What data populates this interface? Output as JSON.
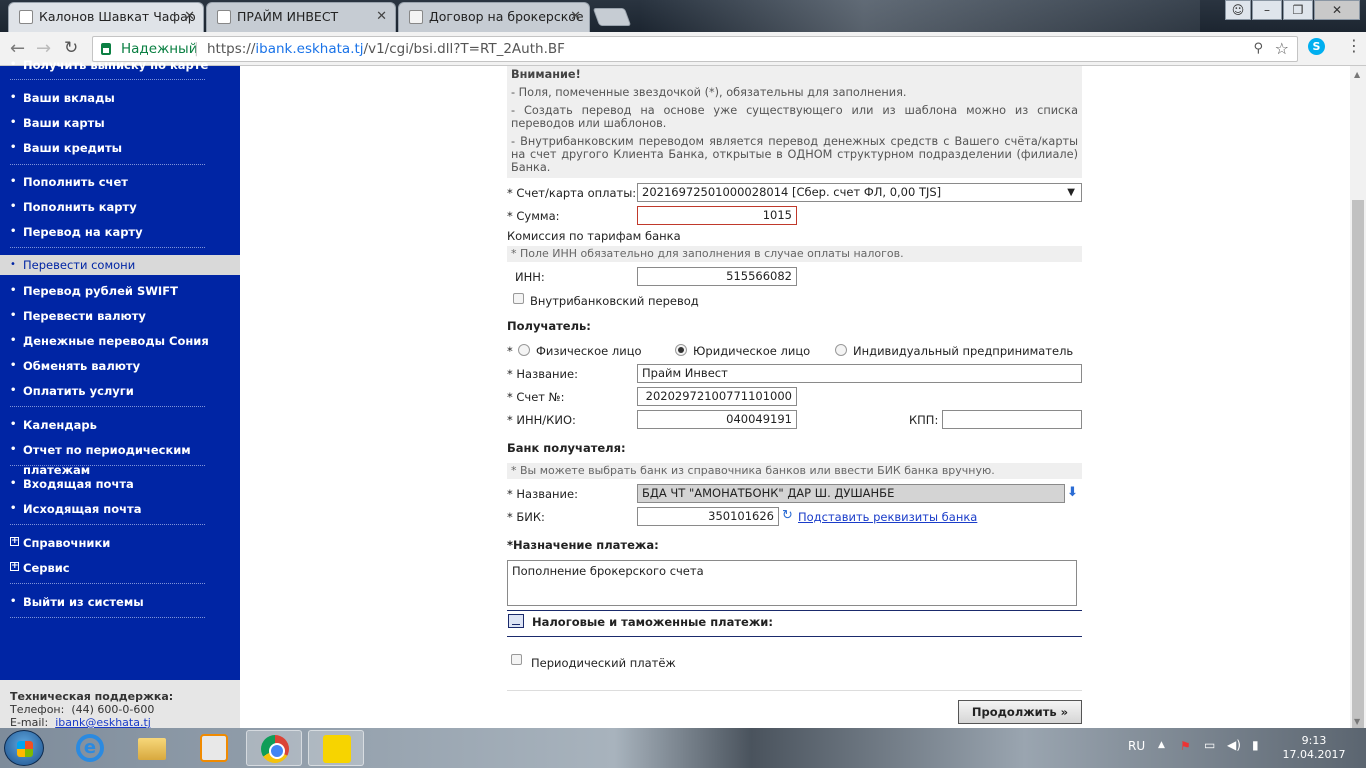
{
  "browser": {
    "tabs": [
      {
        "title": "Калонов Шавкат Чафар",
        "active": true
      },
      {
        "title": "ПРАЙМ ИНВЕСТ",
        "active": false
      },
      {
        "title": "Договор на брокерское",
        "active": false
      }
    ],
    "security_label": "Надежный",
    "url_scheme": "https://",
    "url_host": "ibank.eskhata.tj",
    "url_path": "/v1/cgi/bsi.dll?T=RT_2Auth.BF",
    "skype_letter": "S"
  },
  "sidebar": {
    "items": [
      {
        "label": "Получить выписку по карте",
        "marker": "•"
      },
      {
        "label": "Ваши вклады",
        "marker": "•"
      },
      {
        "label": "Ваши карты",
        "marker": "•"
      },
      {
        "label": "Ваши кредиты",
        "marker": "•"
      },
      {
        "label": "Пополнить счет",
        "marker": "•"
      },
      {
        "label": "Пополнить карту",
        "marker": "•"
      },
      {
        "label": "Перевод на карту",
        "marker": "•"
      },
      {
        "label": "Перевести сомони",
        "marker": "•",
        "active": true
      },
      {
        "label": "Перевод рублей SWIFT",
        "marker": "•"
      },
      {
        "label": "Перевести валюту",
        "marker": "•"
      },
      {
        "label": "Денежные переводы Сония",
        "marker": "•"
      },
      {
        "label": "Обменять валюту",
        "marker": "•"
      },
      {
        "label": "Оплатить услуги",
        "marker": "•"
      },
      {
        "label": "Календарь",
        "marker": "•"
      },
      {
        "label": "Отчет по периодическим платежам",
        "marker": "•"
      },
      {
        "label": "Входящая почта",
        "marker": "•"
      },
      {
        "label": "Исходящая почта",
        "marker": "•"
      },
      {
        "label": "Справочники",
        "marker": "+"
      },
      {
        "label": "Сервис",
        "marker": "+"
      },
      {
        "label": "Выйти из системы",
        "marker": "•"
      }
    ],
    "support": {
      "title": "Техническая поддержка:",
      "phone_label": "Телефон:",
      "phone": "(44) 600-0-600",
      "email_label": "E-mail:",
      "email": "ibank@eskhata.tj"
    }
  },
  "form": {
    "notice": {
      "title": "Внимание!",
      "lines": [
        "- Поля, помеченные звездочкой (*), обязательны для заполнения.",
        "- Создать перевод на основе уже существующего или из шаблона можно из списка переводов или шаблонов.",
        "- Внутрибанковским переводом является перевод денежных средств с Вашего счёта/карты на счет другого Клиента Банка, открытые в ОДНОМ структурном подразделении (филиале) Банка."
      ]
    },
    "account_label": "* Счет/карта оплаты:",
    "account_value": "20216972501000028014 [Сбер. счет ФЛ, 0,00 TJS]",
    "amount_label": "* Сумма:",
    "amount_value": "1015",
    "commission_text": "Комиссия по тарифам банка",
    "inn_hint": "* Поле ИНН обязательно для заполнения в случае оплаты налогов.",
    "inn_label": "ИНН:",
    "inn_value": "515566082",
    "intrabank_label": "Внутрибанковский перевод",
    "recipient_header": "Получатель:",
    "recipient_types": [
      "Физическое лицо",
      "Юридическое лицо",
      "Индивидуальный предприниматель"
    ],
    "recipient_type_selected": "Юридическое лицо",
    "name_label": "* Название:",
    "name_value": "Прайм Инвест",
    "account_no_label": "* Счет №:",
    "account_no_value": "20202972100771101000",
    "inn_kio_label": "* ИНН/КИО:",
    "inn_kio_value": "040049191",
    "kpp_label": "КПП:",
    "kpp_value": "",
    "bank_header": "Банк получателя:",
    "bank_hint": "* Вы можете выбрать банк из справочника банков или ввести БИК банка вручную.",
    "bank_name_label": "* Название:",
    "bank_name_value": "БДА ЧТ \"АМОНАТБОНК\" ДАР Ш. ДУШАНБЕ",
    "bik_label": "* БИК:",
    "bik_value": "350101626",
    "bank_details_link": "Подставить реквизиты банка",
    "purpose_star": "*",
    "purpose_header": "Назначение платежа:",
    "purpose_value": "Пополнение брокерского счета",
    "tax_section": "Налоговые и таможенные платежи:",
    "periodic_label": "Периодический платёж",
    "continue_button": "Продолжить »"
  },
  "taskbar": {
    "language": "RU",
    "time": "9:13",
    "date": "17.04.2017"
  }
}
